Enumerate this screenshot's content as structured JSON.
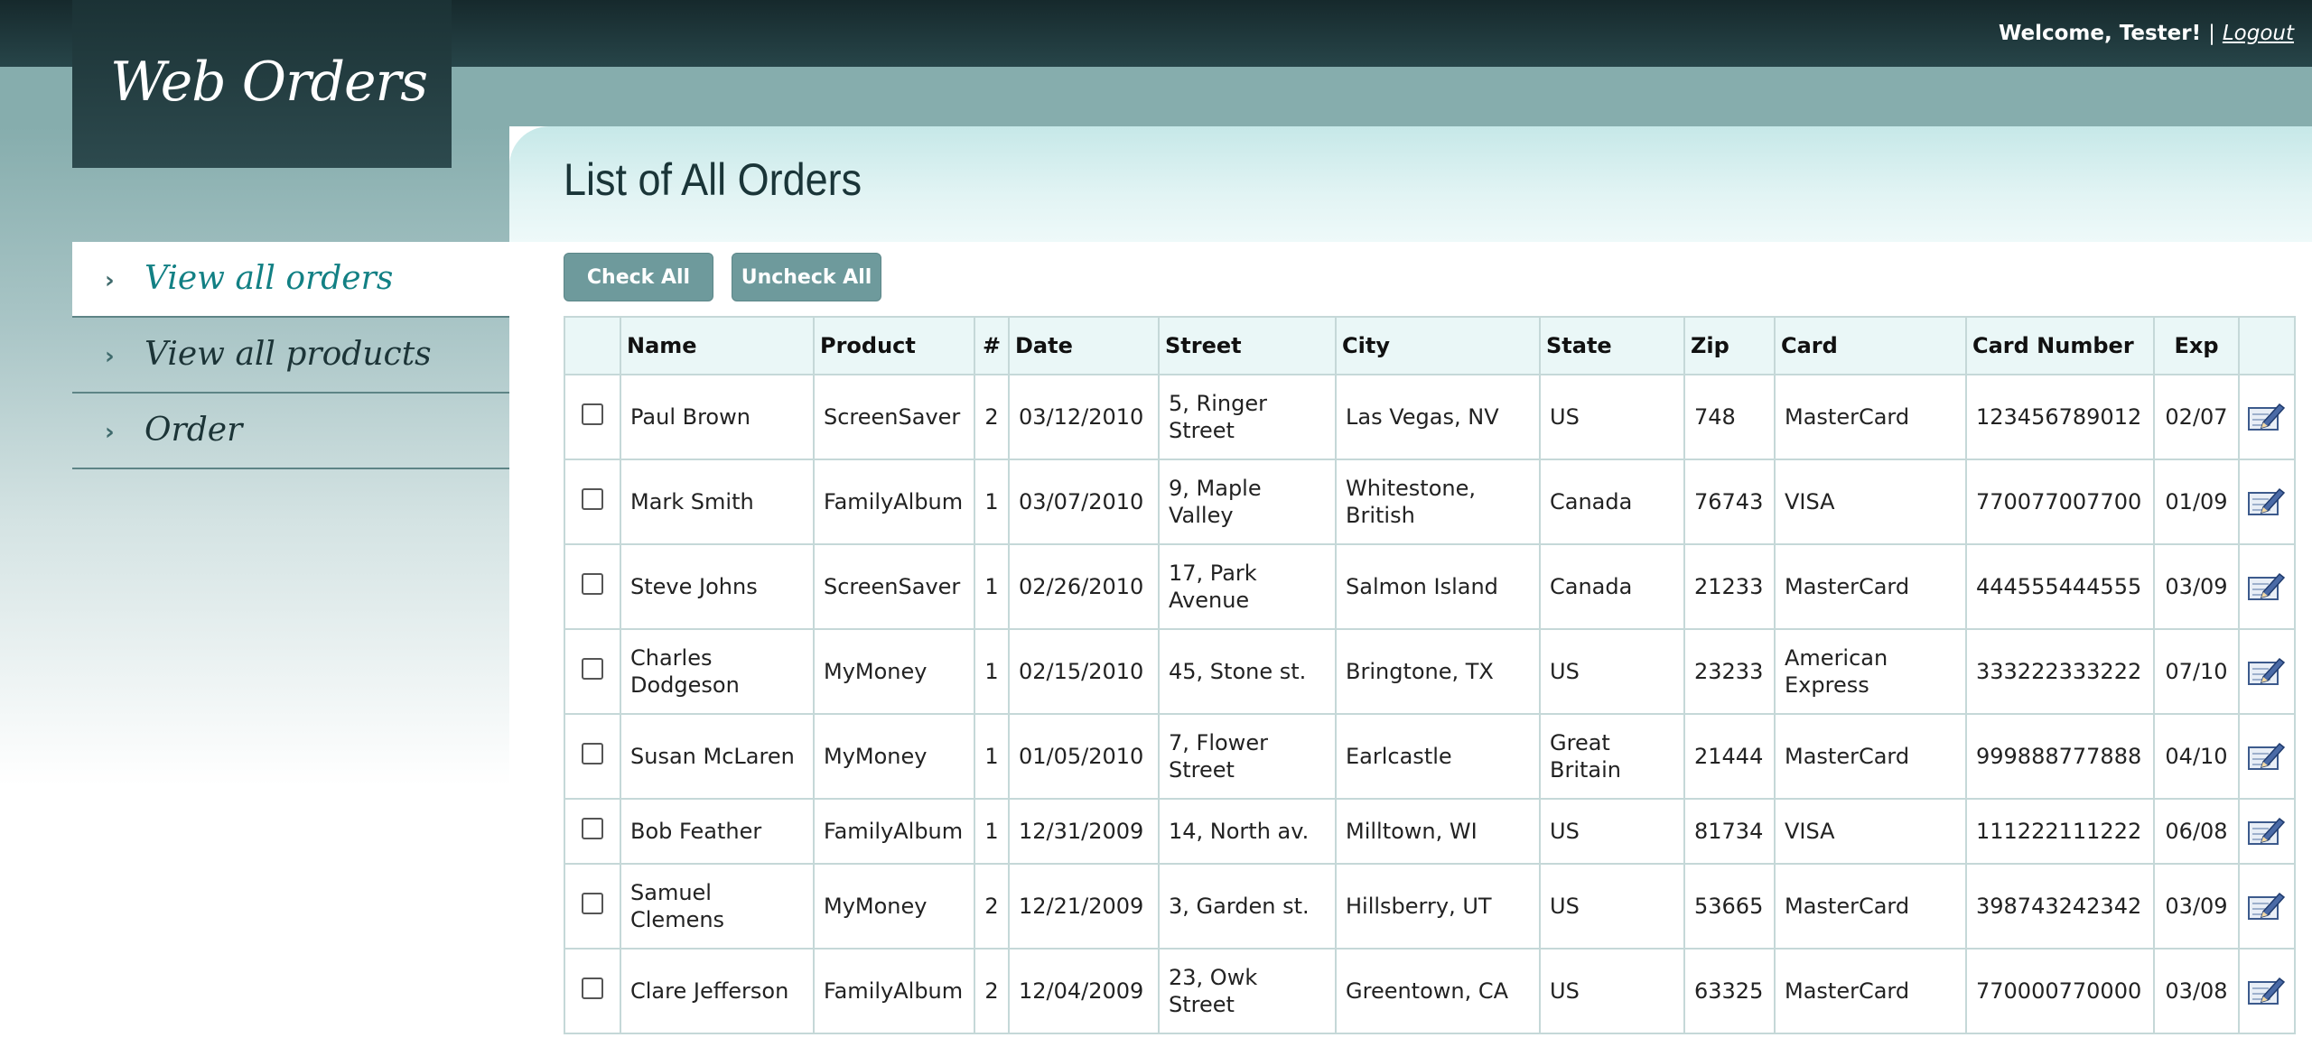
{
  "header": {
    "welcome_text": "Welcome, Tester!",
    "separator": "|",
    "logout_label": "Logout"
  },
  "logo": {
    "title": "Web Orders"
  },
  "nav": {
    "items": [
      {
        "label": "View all orders",
        "active": true
      },
      {
        "label": "View all products",
        "active": false
      },
      {
        "label": "Order",
        "active": false
      }
    ]
  },
  "page": {
    "title": "List of All Orders"
  },
  "buttons": {
    "check_all": "Check All",
    "uncheck_all": "Uncheck All"
  },
  "table": {
    "columns": [
      "",
      "Name",
      "Product",
      "#",
      "Date",
      "Street",
      "City",
      "State",
      "Zip",
      "Card",
      "Card Number",
      "Exp",
      ""
    ],
    "rows": [
      {
        "name": "Paul Brown",
        "product": "ScreenSaver",
        "qty": "2",
        "date": "03/12/2010",
        "street": "5, Ringer Street",
        "city": "Las Vegas, NV",
        "state": "US",
        "zip": "748",
        "card": "MasterCard",
        "card_number": "123456789012",
        "exp": "02/07"
      },
      {
        "name": "Mark Smith",
        "product": "FamilyAlbum",
        "qty": "1",
        "date": "03/07/2010",
        "street": "9, Maple Valley",
        "city": "Whitestone, British",
        "state": "Canada",
        "zip": "76743",
        "card": "VISA",
        "card_number": "770077007700",
        "exp": "01/09"
      },
      {
        "name": "Steve Johns",
        "product": "ScreenSaver",
        "qty": "1",
        "date": "02/26/2010",
        "street": "17, Park Avenue",
        "city": "Salmon Island",
        "state": "Canada",
        "zip": "21233",
        "card": "MasterCard",
        "card_number": "444555444555",
        "exp": "03/09"
      },
      {
        "name": "Charles Dodgeson",
        "product": "MyMoney",
        "qty": "1",
        "date": "02/15/2010",
        "street": "45, Stone st.",
        "city": "Bringtone, TX",
        "state": "US",
        "zip": "23233",
        "card": "American Express",
        "card_number": "333222333222",
        "exp": "07/10"
      },
      {
        "name": "Susan McLaren",
        "product": "MyMoney",
        "qty": "1",
        "date": "01/05/2010",
        "street": "7, Flower Street",
        "city": "Earlcastle",
        "state": "Great Britain",
        "zip": "21444",
        "card": "MasterCard",
        "card_number": "999888777888",
        "exp": "04/10"
      },
      {
        "name": "Bob Feather",
        "product": "FamilyAlbum",
        "qty": "1",
        "date": "12/31/2009",
        "street": "14, North av.",
        "city": "Milltown, WI",
        "state": "US",
        "zip": "81734",
        "card": "VISA",
        "card_number": "111222111222",
        "exp": "06/08"
      },
      {
        "name": "Samuel Clemens",
        "product": "MyMoney",
        "qty": "2",
        "date": "12/21/2009",
        "street": "3, Garden st.",
        "city": "Hillsberry, UT",
        "state": "US",
        "zip": "53665",
        "card": "MasterCard",
        "card_number": "398743242342",
        "exp": "03/09"
      },
      {
        "name": "Clare Jefferson",
        "product": "FamilyAlbum",
        "qty": "2",
        "date": "12/04/2009",
        "street": "23, Owk Street",
        "city": "Greentown, CA",
        "state": "US",
        "zip": "63325",
        "card": "MasterCard",
        "card_number": "770000770000",
        "exp": "03/08"
      }
    ]
  },
  "icons": {
    "edit": "edit-icon",
    "nav_bullet": "chevron-right-icon"
  },
  "colors": {
    "topbar": "#1b3235",
    "band": "#86adad",
    "nav_active_text": "#128084",
    "button_bg": "#6e9a9c",
    "table_header_bg": "#eaf7f7",
    "table_border": "#c5d8d8"
  }
}
